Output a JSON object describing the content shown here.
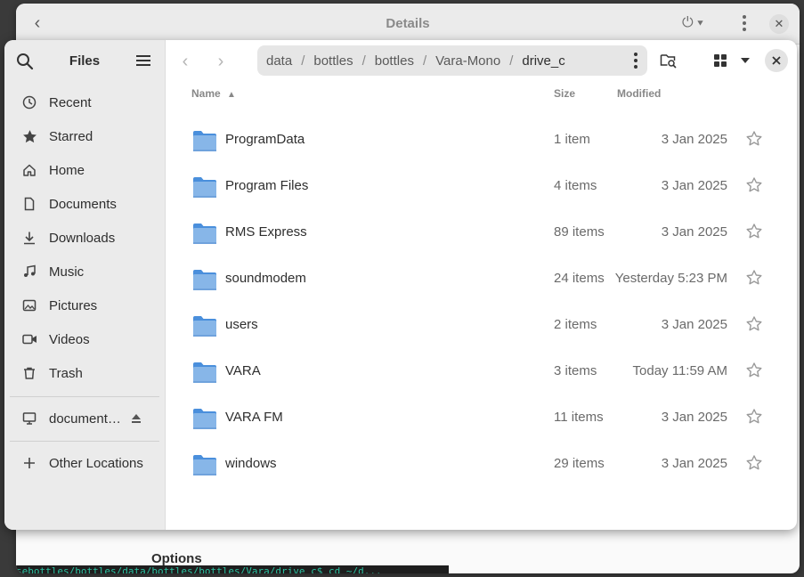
{
  "background_window": {
    "title": "Details",
    "options_label": "Options",
    "terminal_text": "sebottles/bottles/data/bottles/bottles/Vara/drive_c$  cd ~/d..."
  },
  "files_window": {
    "title": "Files",
    "sidebar": {
      "items": [
        {
          "label": "Recent",
          "icon": "recent-icon"
        },
        {
          "label": "Starred",
          "icon": "star-icon"
        },
        {
          "label": "Home",
          "icon": "home-icon"
        },
        {
          "label": "Documents",
          "icon": "document-icon"
        },
        {
          "label": "Downloads",
          "icon": "download-icon"
        },
        {
          "label": "Music",
          "icon": "music-icon"
        },
        {
          "label": "Pictures",
          "icon": "pictures-icon"
        },
        {
          "label": "Videos",
          "icon": "videos-icon"
        },
        {
          "label": "Trash",
          "icon": "trash-icon"
        }
      ],
      "mounts": [
        {
          "label": "document…",
          "icon": "drive-icon"
        }
      ],
      "other_locations": "Other Locations"
    },
    "path": [
      "data",
      "bottles",
      "bottles",
      "Vara-Mono",
      "drive_c"
    ],
    "columns": {
      "name": "Name",
      "size": "Size",
      "modified": "Modified"
    },
    "files": [
      {
        "name": "ProgramData",
        "size": "1 item",
        "modified": "3 Jan 2025"
      },
      {
        "name": "Program Files",
        "size": "4 items",
        "modified": "3 Jan 2025"
      },
      {
        "name": "RMS Express",
        "size": "89 items",
        "modified": "3 Jan 2025"
      },
      {
        "name": "soundmodem",
        "size": "24 items",
        "modified": "Yesterday 5:23 PM"
      },
      {
        "name": "users",
        "size": "2 items",
        "modified": "3 Jan 2025"
      },
      {
        "name": "VARA",
        "size": "3 items",
        "modified": "Today 11:59 AM"
      },
      {
        "name": "VARA FM",
        "size": "11 items",
        "modified": "3 Jan 2025"
      },
      {
        "name": "windows",
        "size": "29 items",
        "modified": "3 Jan 2025"
      }
    ]
  },
  "colors": {
    "folder": "#87b6e8",
    "folder_dark": "#4a8fdc",
    "sidebar_bg": "#ebebeb"
  }
}
